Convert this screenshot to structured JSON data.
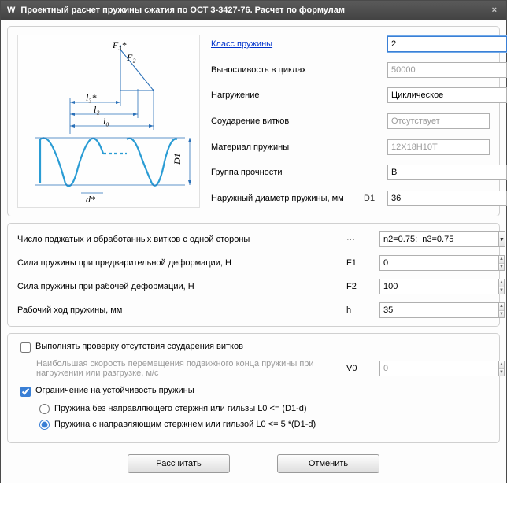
{
  "titlebar": {
    "app_icon": "W",
    "title": "Проектный расчет пружины сжатия по ОСТ 3-3427-76. Расчет по формулам",
    "close": "×"
  },
  "upper": {
    "klass_label": "Класс пружины",
    "klass_value": "2",
    "vynos_label": "Выносливость в циклах",
    "vynos_value": "50000",
    "nagr_label": "Нагружение",
    "nagr_value": "Циклическое",
    "soud_label": "Соударение витков",
    "soud_value": "Отсутствует",
    "mat_label": "Материал пружины",
    "mat_value": "12X18H10T",
    "grup_label": "Группа прочности",
    "grup_value": "B",
    "diam_label": "Наружный диаметр пружины, мм",
    "diam_sym": "D1",
    "diam_value": "36"
  },
  "middle": {
    "vitkov_label": "Число поджатых и обработанных витков с одной стороны",
    "vitkov_sym": "···",
    "vitkov_value": "n2=0.75;  n3=0.75",
    "f1_label": "Сила пружины при предварительной деформации, Н",
    "f1_sym": "F1",
    "f1_value": "0",
    "f2_label": "Сила пружины при рабочей деформации, Н",
    "f2_sym": "F2",
    "f2_value": "100",
    "h_label": "Рабочий ход пружины, мм",
    "h_sym": "h",
    "h_value": "35"
  },
  "lower": {
    "check1_label": "Выполнять проверку отсутствия соударения витков",
    "vel_label": "Наибольшая скорость перемещения подвижного конца пружины при нагружении или разгрузке, м/с",
    "vel_sym": "V0",
    "vel_value": "0",
    "check2_label": "Ограничение на устойчивость пружины",
    "radio1_label": "Пружина без направляющего стержня или гильзы   L0 <= (D1-d)",
    "radio2_label": "Пружина с направляющим стержнем или гильзой   L0 <= 5 *(D1-d)"
  },
  "buttons": {
    "calc": "Рассчитать",
    "cancel": "Отменить"
  },
  "diagram": {
    "F3": "F₃*",
    "F2": "F₂",
    "l3": "l₃*",
    "l2": "l₂",
    "l0": "l₀",
    "D1": "D1",
    "d": "d*"
  }
}
